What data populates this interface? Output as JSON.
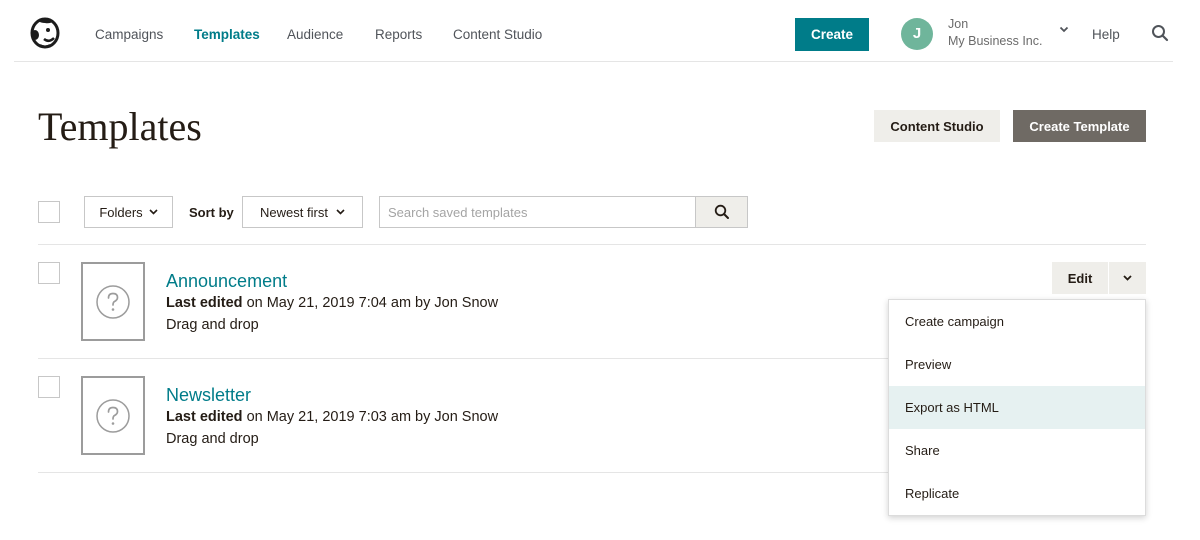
{
  "nav": {
    "items": [
      {
        "label": "Campaigns",
        "active": false
      },
      {
        "label": "Templates",
        "active": true
      },
      {
        "label": "Audience",
        "active": false
      },
      {
        "label": "Reports",
        "active": false
      },
      {
        "label": "Content Studio",
        "active": false
      }
    ],
    "create_label": "Create",
    "account": {
      "initial": "J",
      "name": "Jon",
      "org": "My Business Inc."
    },
    "help_label": "Help",
    "icons": {
      "logo": "freddie-logo-icon",
      "account_menu": "chevron-down-icon",
      "search": "search-icon"
    }
  },
  "page": {
    "title": "Templates",
    "content_studio_label": "Content Studio",
    "create_template_label": "Create Template"
  },
  "toolbar": {
    "folders_label": "Folders",
    "sort_label": "Sort by",
    "sort_value": "Newest first",
    "search_placeholder": "Search saved templates"
  },
  "templates": [
    {
      "name": "Announcement",
      "last_edited_label": "Last edited",
      "last_edited_rest": " on May 21, 2019 7:04 am by Jon Snow",
      "type": "Drag and drop"
    },
    {
      "name": "Newsletter",
      "last_edited_label": "Last edited",
      "last_edited_rest": " on May 21, 2019 7:03 am by Jon Snow",
      "type": "Drag and drop"
    }
  ],
  "row_actions": {
    "edit_label": "Edit",
    "menu": [
      "Create campaign",
      "Preview",
      "Export as HTML",
      "Share",
      "Replicate"
    ],
    "highlighted_item": "Export as HTML"
  },
  "colors": {
    "accent": "#007c89",
    "avatar": "#6fb59b",
    "primary_button": "#6f6a64",
    "secondary_button": "#efeeea",
    "menu_highlight": "#e6f1f1"
  }
}
